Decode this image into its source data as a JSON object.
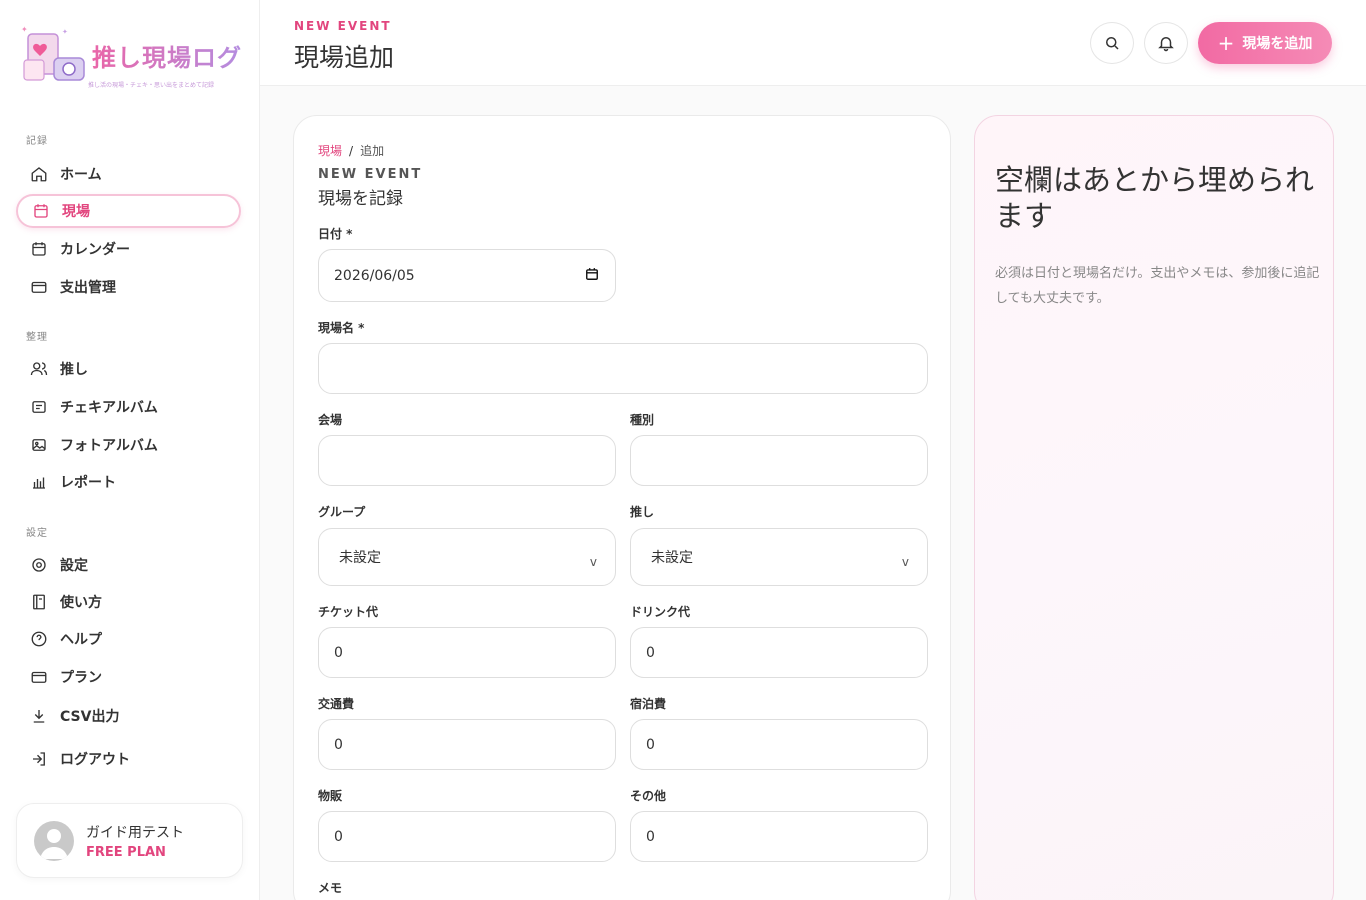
{
  "app": {
    "logo_title": "推し現場ログ",
    "logo_subtitle": "推し活の現場・チェキ・思い出をまとめて記録"
  },
  "sidebar": {
    "sections": [
      {
        "label": "記録"
      },
      {
        "label": "整理"
      },
      {
        "label": "設定"
      }
    ],
    "items": [
      {
        "label": "ホーム",
        "icon": "home-icon"
      },
      {
        "label": "現場",
        "icon": "calendar-icon",
        "active": true
      },
      {
        "label": "カレンダー",
        "icon": "calendar-icon"
      },
      {
        "label": "支出管理",
        "icon": "credit-card-icon"
      },
      {
        "label": "推し",
        "icon": "users-icon"
      },
      {
        "label": "チェキアルバム",
        "icon": "album-icon"
      },
      {
        "label": "フォトアルバム",
        "icon": "image-icon"
      },
      {
        "label": "レポート",
        "icon": "bar-chart-icon"
      },
      {
        "label": "設定",
        "icon": "gear-icon"
      },
      {
        "label": "使い方",
        "icon": "book-icon"
      },
      {
        "label": "ヘルプ",
        "icon": "help-icon"
      },
      {
        "label": "プラン",
        "icon": "credit-card-icon"
      },
      {
        "label": "CSV出力",
        "icon": "download-icon"
      },
      {
        "label": "ログアウト",
        "icon": "logout-icon"
      }
    ],
    "profile": {
      "name": "ガイド用テスト",
      "plan": "FREE PLAN"
    }
  },
  "header": {
    "eyebrow": "NEW EVENT",
    "title": "現場追加",
    "add_button_label": "現場を追加"
  },
  "form": {
    "breadcrumb": {
      "parent": "現場",
      "separator": "/",
      "current": "追加"
    },
    "eyebrow": "NEW EVENT",
    "title": "現場を記録",
    "fields": {
      "date": {
        "label": "日付 *",
        "value": "2026/06/05"
      },
      "event_name": {
        "label": "現場名 *",
        "value": ""
      },
      "venue": {
        "label": "会場",
        "value": ""
      },
      "type": {
        "label": "種別",
        "value": ""
      },
      "group": {
        "label": "グループ",
        "value": "未設定"
      },
      "oshi": {
        "label": "推し",
        "value": "未設定"
      },
      "ticket": {
        "label": "チケット代",
        "value": "0"
      },
      "drink": {
        "label": "ドリンク代",
        "value": "0"
      },
      "transport": {
        "label": "交通費",
        "value": "0"
      },
      "lodging": {
        "label": "宿泊費",
        "value": "0"
      },
      "merch": {
        "label": "物販",
        "value": "0"
      },
      "other": {
        "label": "その他",
        "value": "0"
      },
      "memo": {
        "label": "メモ"
      }
    }
  },
  "tip": {
    "title": "空欄はあとから埋められます",
    "text": "必須は日付と現場名だけ。支出やメモは、参加後に追記しても大丈夫です。"
  },
  "colors": {
    "accent": "#e2457e",
    "accent_light": "#f26aa3",
    "active_border": "#f6c3d8"
  }
}
